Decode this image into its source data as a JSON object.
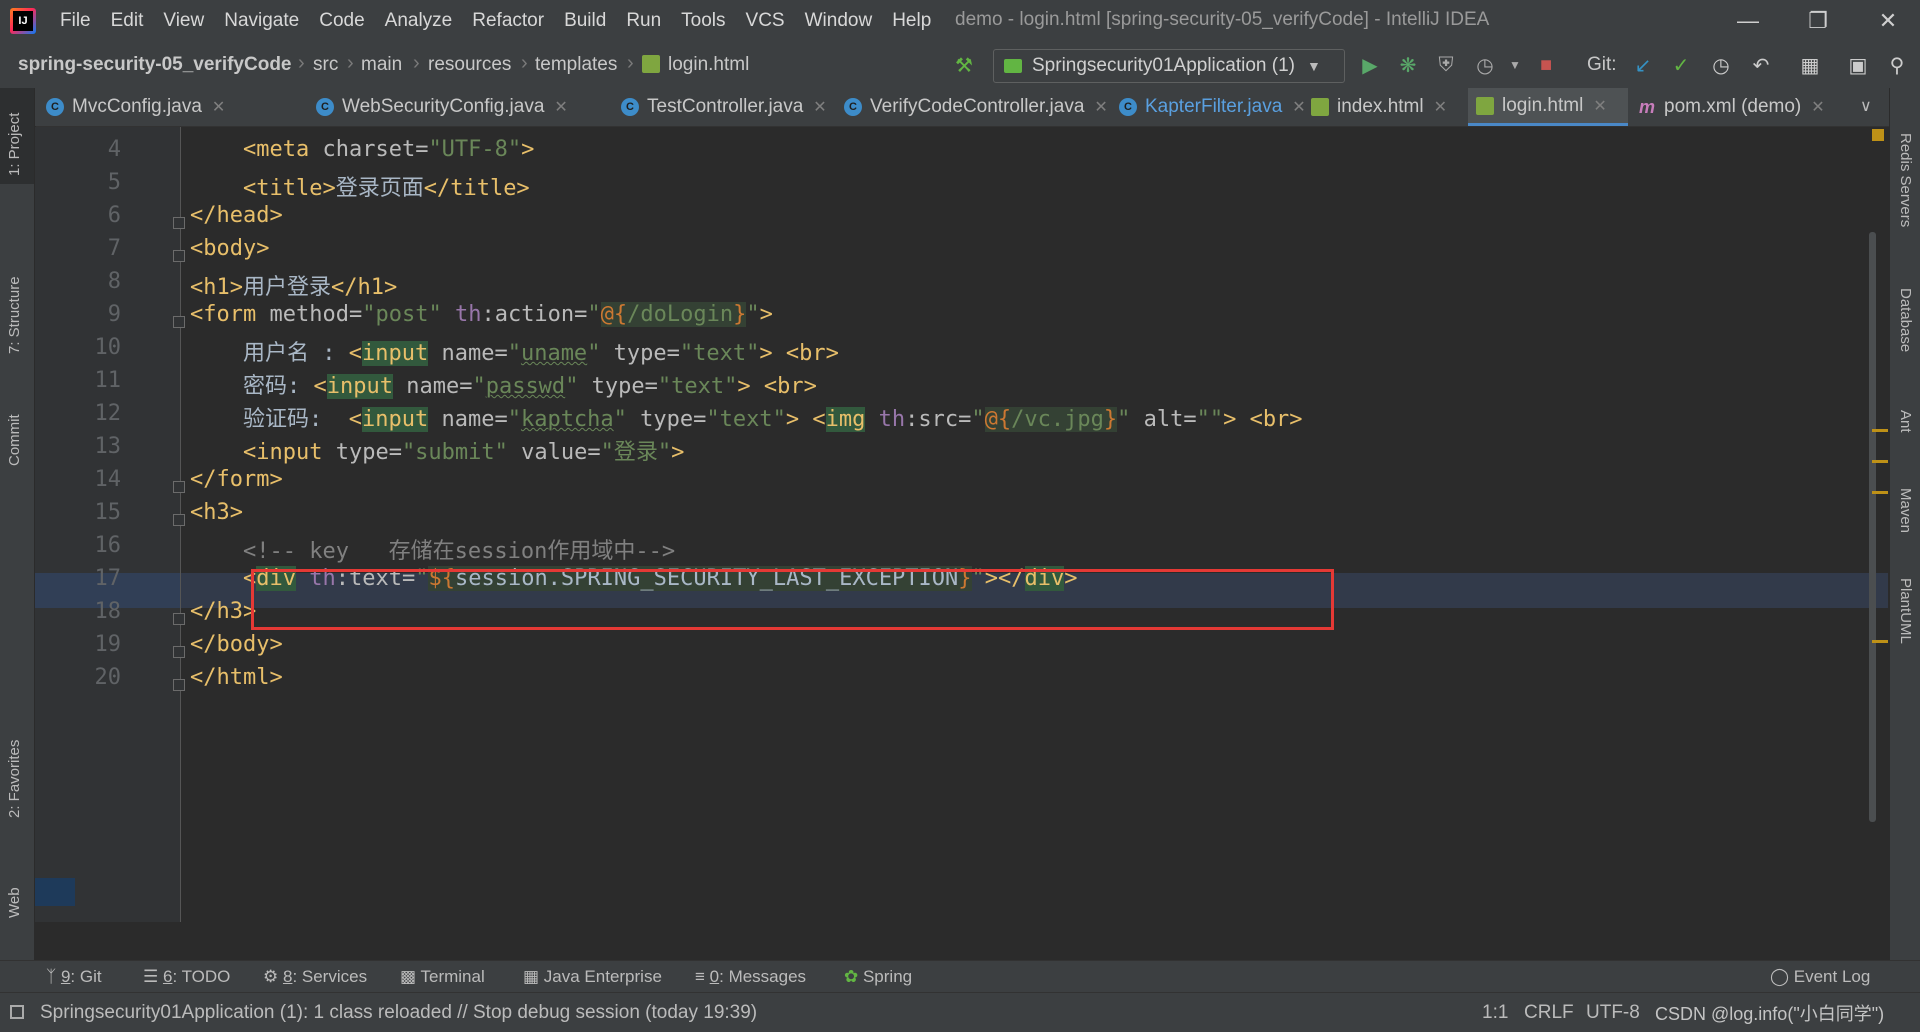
{
  "window": {
    "title": "demo - login.html [spring-security-05_verifyCode] - IntelliJ IDEA"
  },
  "menu": [
    "File",
    "Edit",
    "View",
    "Navigate",
    "Code",
    "Analyze",
    "Refactor",
    "Build",
    "Run",
    "Tools",
    "VCS",
    "Window",
    "Help"
  ],
  "breadcrumb": [
    "spring-security-05_verifyCode",
    "src",
    "main",
    "resources",
    "templates",
    "login.html"
  ],
  "run_config": "Springsecurity01Application (1)",
  "git_label": "Git:",
  "tabs": [
    {
      "label": "MvcConfig.java",
      "icon": "class-icon"
    },
    {
      "label": "WebSecurityConfig.java",
      "icon": "class-icon"
    },
    {
      "label": "TestController.java",
      "icon": "class-icon"
    },
    {
      "label": "VerifyCodeController.java",
      "icon": "class-icon"
    },
    {
      "label": "KapterFilter.java",
      "icon": "class-icon"
    },
    {
      "label": "index.html",
      "icon": "html-icon"
    },
    {
      "label": "login.html",
      "icon": "html-icon",
      "active": true
    },
    {
      "label": "pom.xml (demo)",
      "icon": "maven-icon"
    }
  ],
  "left_tools": [
    "1: Project",
    "7: Structure",
    "Commit",
    "2: Favorites",
    "Web"
  ],
  "right_tools": [
    "Redis Servers",
    "Database",
    "Ant",
    "Maven",
    "PlantUML"
  ],
  "line_numbers": [
    "4",
    "5",
    "6",
    "7",
    "8",
    "9",
    "10",
    "11",
    "12",
    "13",
    "14",
    "15",
    "16",
    "17",
    "18",
    "19",
    "20"
  ],
  "code": {
    "l4": {
      "t1": "<meta ",
      "a1": "charset",
      "e": "=",
      "s1": "\"UTF-8\"",
      "t2": ">"
    },
    "l5": {
      "t1": "<title>",
      "text": "登录页面",
      "t2": "</title>"
    },
    "l6": {
      "t1": "</head>"
    },
    "l7": {
      "t1": "<body>"
    },
    "l8": {
      "t1": "<h1>",
      "text": "用户登录",
      "t2": "</h1>"
    },
    "l9": {
      "t1": "<form ",
      "a1": "method",
      "s1": "\"post\"",
      "ns": "th",
      "a2": ":action",
      "s2a": "\"",
      "s2b": "@{",
      "s2c": "/doLogin",
      "s2d": "}",
      "s2e": "\"",
      "t2": ">"
    },
    "l10": {
      "text": "用户名 : ",
      "t1": "<",
      "tag": "input",
      "a1": " name",
      "s1a": "\"",
      "s1b": "uname",
      "s1c": "\"",
      "a2": " type",
      "s2": "\"text\"",
      "t2": "> <br>"
    },
    "l11": {
      "text": "密码: ",
      "t1": "<",
      "tag": "input",
      "a1": " name",
      "s1a": "\"",
      "s1b": "passwd",
      "s1c": "\"",
      "a2": " type",
      "s2": "\"text\"",
      "t2": "> <br>"
    },
    "l12": {
      "text": "验证码:  ",
      "t1": "<",
      "tag": "input",
      "a1": " name",
      "s1a": "\"",
      "s1b": "kaptcha",
      "s1c": "\"",
      "a2": " type",
      "s2": "\"text\"",
      "t2": "> <",
      "tag2": "img",
      "ns": " th",
      "a3": ":src",
      "s3a": "\"",
      "s3b": "@{",
      "s3c": "/vc.jpg",
      "s3d": "}",
      "s3e": "\"",
      "a4": " alt",
      "s4": "\"\"",
      "t3": "> <br>"
    },
    "l13": {
      "t1": "<input ",
      "a1": "type",
      "s1": "\"submit\"",
      "a2": " value",
      "s2": "\"登录\"",
      "t2": ">"
    },
    "l14": {
      "t1": "</form>"
    },
    "l15": {
      "t1": "<h3>"
    },
    "l16": {
      "cmt": "<!-- key   存储在session作用域中-->"
    },
    "l17": {
      "t1": "<",
      "tag": "div",
      "ns": " th",
      "a1": ":text",
      "s1a": "\"",
      "s1b": "${",
      "s1c": "session.SPRING_SECURITY_LAST_EXCEPTION",
      "s1d": "}",
      "s1e": "\"",
      "t2": "></",
      "tag2": "div",
      "t3": ">"
    },
    "l18": {
      "t1": "</h3>"
    },
    "l19": {
      "t1": "</body>"
    },
    "l20": {
      "t1": "</html>"
    }
  },
  "bottom_tools": [
    {
      "key": "9",
      "label": ": Git"
    },
    {
      "key": "6",
      "label": ": TODO"
    },
    {
      "key": "8",
      "label": ": Services"
    },
    {
      "key": "",
      "label": "Terminal"
    },
    {
      "key": "",
      "label": "Java Enterprise"
    },
    {
      "key": "0",
      "label": ": Messages"
    },
    {
      "key": "",
      "label": "Spring"
    }
  ],
  "event_log": "Event Log",
  "status": {
    "message": "Springsecurity01Application (1): 1 class reloaded // Stop debug session (today 19:39)",
    "position": "1:1",
    "line_sep": "CRLF",
    "encoding": "UTF-8",
    "watermark": "CSDN @log.info(\"小白同学\")"
  }
}
